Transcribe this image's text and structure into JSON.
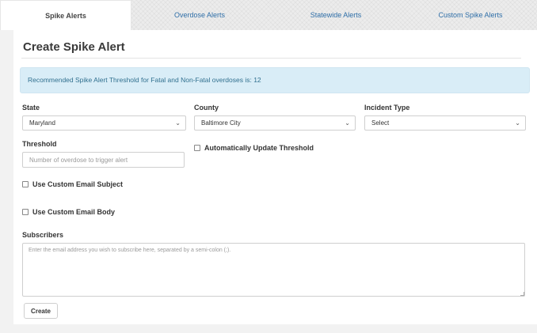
{
  "tabs": [
    {
      "label": "Spike Alerts",
      "active": true
    },
    {
      "label": "Overdose Alerts",
      "active": false
    },
    {
      "label": "Statewide Alerts",
      "active": false
    },
    {
      "label": "Custom Spike Alerts",
      "active": false
    }
  ],
  "form": {
    "title": "Create Spike Alert",
    "alert_text": "Recommended Spike Alert Threshold for Fatal and Non-Fatal overdoses is: 12",
    "state": {
      "label": "State",
      "value": "Maryland"
    },
    "county": {
      "label": "County",
      "value": "Baltimore City"
    },
    "incident_type": {
      "label": "Incident Type",
      "value": "Select"
    },
    "threshold": {
      "label": "Threshold",
      "placeholder": "Number of overdose to trigger alert"
    },
    "auto_update_label": "Automatically Update Threshold",
    "custom_subject_label": "Use Custom Email Subject",
    "custom_body_label": "Use Custom Email Body",
    "subscribers": {
      "label": "Subscribers",
      "placeholder": "Enter the email address you wish to subscribe here, separated by a semi-colon (;)."
    },
    "create_label": "Create"
  },
  "icons": {
    "select_chevron": "chevron-down-icon"
  },
  "colors": {
    "tab_link": "#2f6fa8",
    "alert_bg": "#d9edf7",
    "alert_text": "#31708f"
  }
}
